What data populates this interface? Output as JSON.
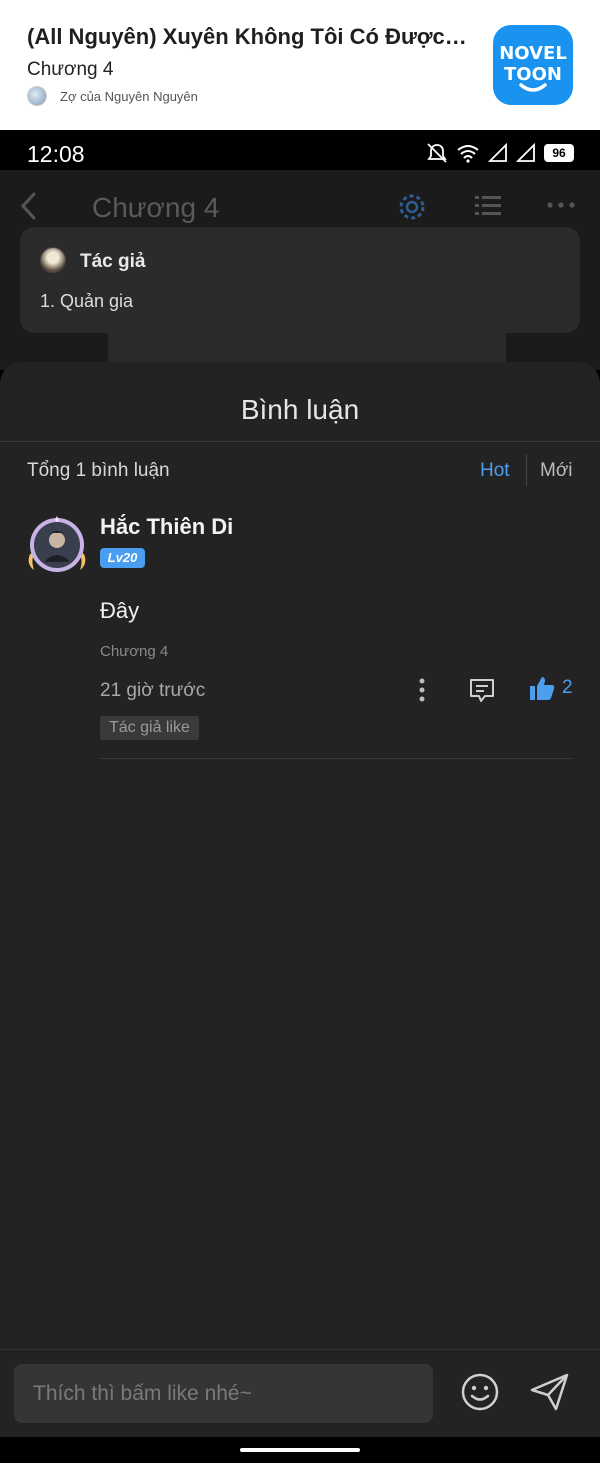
{
  "web_header": {
    "title": "(All Nguyên) Xuyên Không Tôi Có Được Tất Cả",
    "chapter": "Chương 4",
    "author": "Zợ của Nguyên Nguyên",
    "logo_line1": "NOVEL",
    "logo_line2": "TOON",
    "logo_color": "#1a93f0"
  },
  "status_bar": {
    "time": "12:08",
    "battery": "96"
  },
  "reader": {
    "title": "Chương 4",
    "author_card": {
      "label": "Tác giả",
      "note": "1. Quản gia"
    }
  },
  "comments_sheet": {
    "title": "Bình luận",
    "total": "Tổng 1 bình luận",
    "sort_hot": "Hot",
    "sort_new": "Mới",
    "accent_color": "#4c9ef0",
    "comments": [
      {
        "user": "Hắc Thiên Di",
        "level": "Lv20",
        "text": "Đây",
        "chapter": "Chương 4",
        "time": "21 giờ trước",
        "likes": "2",
        "author_like": "Tác giả like"
      }
    ]
  },
  "input": {
    "placeholder": "Thích thì bấm like nhé~"
  }
}
